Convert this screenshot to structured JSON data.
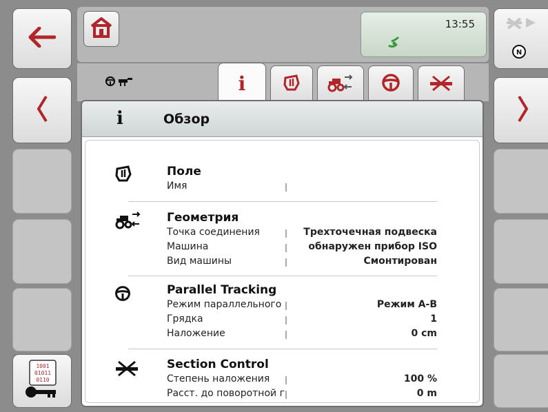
{
  "status": {
    "time": "13:55"
  },
  "left_buttons": {
    "back_icon": "arrow-left",
    "prev_icon": "chevron-left",
    "keys_icon": "binary-key"
  },
  "right_buttons": {
    "next_icon": "chevron-right",
    "nav_icon": "compass-n",
    "compass_letter": "N"
  },
  "tabs": [
    {
      "icon": "info-i",
      "glyph": "i",
      "active": true
    },
    {
      "icon": "field"
    },
    {
      "icon": "geometry-tractor"
    },
    {
      "icon": "steering-wheel"
    },
    {
      "icon": "section-control"
    }
  ],
  "page": {
    "title": "Обзор",
    "header_glyph": "i"
  },
  "sections": {
    "field": {
      "title": "Поле",
      "rows": [
        {
          "label": "Имя",
          "value": ""
        }
      ]
    },
    "geometry": {
      "title": "Геометрия",
      "rows": [
        {
          "label": "Точка соединения",
          "value": "Трехточечная подвеска"
        },
        {
          "label": "Машина",
          "value": "обнаружен прибор ISO"
        },
        {
          "label": "Вид машины",
          "value": "Смонтирован"
        }
      ]
    },
    "tracking": {
      "title": "Parallel Tracking",
      "rows": [
        {
          "label": "Режим параллельного",
          "value": "Режим A-B"
        },
        {
          "label": "Грядка",
          "value": "1"
        },
        {
          "label": "Наложение",
          "value": "0 cm"
        }
      ]
    },
    "section_control": {
      "title": "Section Control",
      "rows": [
        {
          "label": "Степень наложения",
          "value": "100 %"
        },
        {
          "label": "Расст. до поворотной г",
          "value": "0 m"
        }
      ]
    }
  },
  "colors": {
    "accent": "#b0262a",
    "status_green": "#3a9a3a",
    "background": "#8c8c8c"
  }
}
